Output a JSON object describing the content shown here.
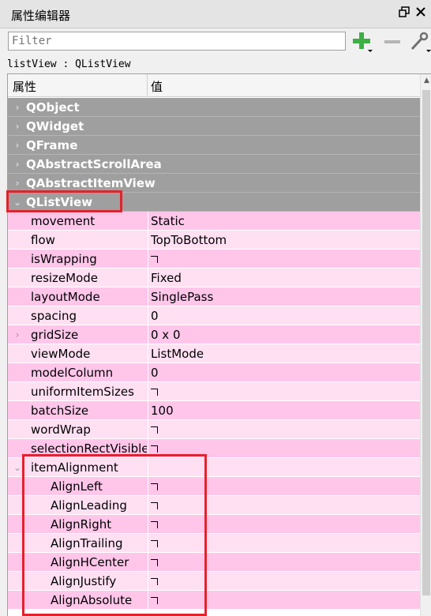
{
  "window": {
    "title": "属性编辑器",
    "float_icon": "float-window-icon",
    "close_icon": "close-icon"
  },
  "filter": {
    "placeholder": "Filter"
  },
  "object_line": "listView : QListView",
  "header": {
    "col1": "属性",
    "col2": "值"
  },
  "groups": [
    "QObject",
    "QWidget",
    "QFrame",
    "QAbstractScrollArea",
    "QAbstractItemView"
  ],
  "listview": {
    "label": "QListView",
    "properties": [
      {
        "name": "movement",
        "value": "Static",
        "shade": "dark"
      },
      {
        "name": "flow",
        "value": "TopToBottom",
        "shade": "light"
      },
      {
        "name": "isWrapping",
        "value": "",
        "checkbox": true,
        "shade": "dark"
      },
      {
        "name": "resizeMode",
        "value": "Fixed",
        "shade": "light"
      },
      {
        "name": "layoutMode",
        "value": "SinglePass",
        "shade": "dark"
      },
      {
        "name": "spacing",
        "value": "0",
        "shade": "light"
      },
      {
        "name": "gridSize",
        "value": "0 x 0",
        "shade": "dark",
        "expandable": true
      },
      {
        "name": "viewMode",
        "value": "ListMode",
        "shade": "light"
      },
      {
        "name": "modelColumn",
        "value": "0",
        "shade": "dark"
      },
      {
        "name": "uniformItemSizes",
        "value": "",
        "checkbox": true,
        "shade": "light"
      },
      {
        "name": "batchSize",
        "value": "100",
        "shade": "dark"
      },
      {
        "name": "wordWrap",
        "value": "",
        "checkbox": true,
        "shade": "light"
      },
      {
        "name": "selectionRectVisible",
        "value": "",
        "checkbox": true,
        "shade": "dark"
      }
    ],
    "item_alignment": {
      "label": "itemAlignment",
      "flags": [
        "AlignLeft",
        "AlignLeading",
        "AlignRight",
        "AlignTrailing",
        "AlignHCenter",
        "AlignJustify",
        "AlignAbsolute"
      ]
    }
  },
  "colors": {
    "group_bg": "#9f9f9f",
    "row_dark": "#ffc6ea",
    "row_light": "#ffe0f3",
    "highlight": "#e8202a",
    "add_green": "#3cb043"
  }
}
